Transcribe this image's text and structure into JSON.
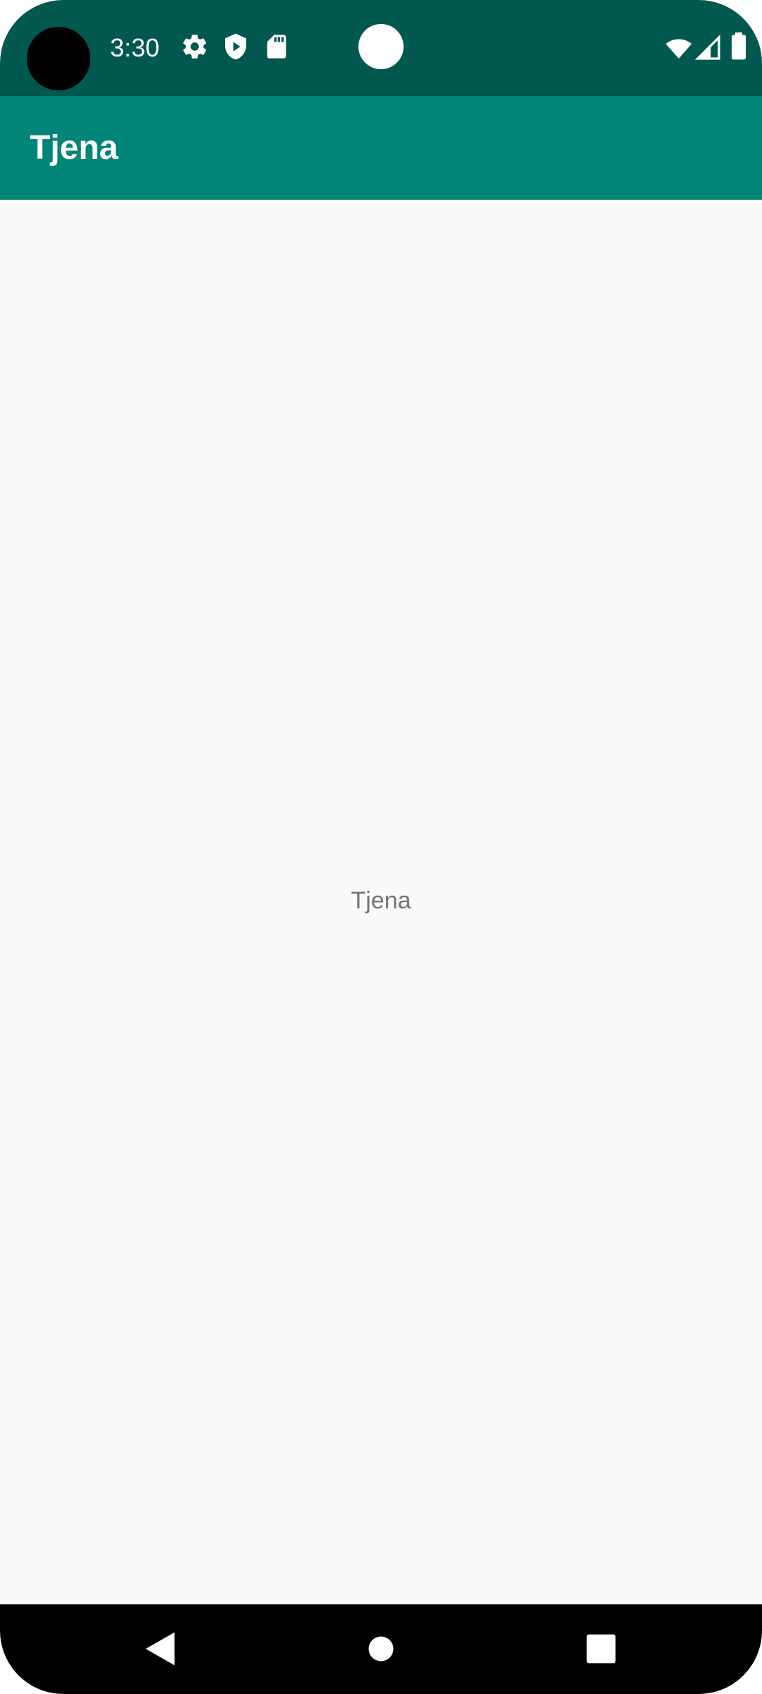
{
  "status_bar": {
    "time": "3:30",
    "left_icons": [
      "gear-icon",
      "play-shield-icon",
      "sd-card-icon"
    ],
    "right_icons": [
      "wifi-icon",
      "cellular-signal-icon",
      "battery-icon"
    ],
    "background": "#00584e"
  },
  "app_bar": {
    "title": "Tjena",
    "background": "#008577"
  },
  "main": {
    "text": "Tjena",
    "background": "#fafafa"
  },
  "nav_bar": {
    "buttons": [
      "back-icon",
      "home-icon",
      "recents-icon"
    ]
  }
}
